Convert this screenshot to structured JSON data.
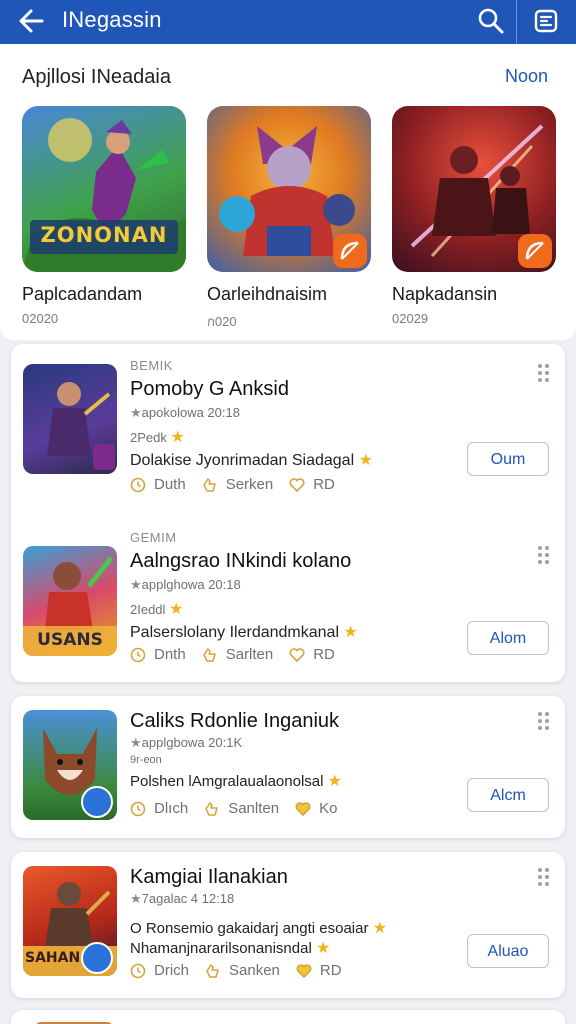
{
  "topbar": {
    "title": "INegassin",
    "icons": [
      "back-arrow-icon",
      "search-icon",
      "menu-icon"
    ],
    "color": "#1f56b8"
  },
  "featured": {
    "title": "Apjllosi INeadaia",
    "more": "Noon",
    "items": [
      {
        "name": "Paplcadandam",
        "sub": "02020",
        "thumb_text": "ZONONAN"
      },
      {
        "name": "Oarleihdnaisim",
        "sub": "ก020"
      },
      {
        "name": "Napkadansin",
        "sub": "02029"
      }
    ]
  },
  "list": [
    {
      "tag": "BEMIK",
      "name": "Pomoby G Anksid",
      "meta": "apokolowa 20:18",
      "meta2": "2Pedk",
      "desc": "Dolakise Jyonrimadan Siadagal",
      "actions": [
        "Duth",
        "Serken",
        "RD"
      ],
      "button": "Oum"
    },
    {
      "tag": "GEMIM",
      "name": "Aalngsrao INkindi kolano",
      "meta": "applghowa 20:18",
      "meta2": "2Ieddl",
      "desc": "Palserslolany Ilerdandmkanal",
      "actions": [
        "Dnth",
        "Sarlten",
        "RD"
      ],
      "button": "Alom",
      "thumb_text": "USANS"
    },
    {
      "name": "Caliks Rdonlie Inganiuk",
      "meta": "applgbowa 20:1K",
      "meta2": "9r-eon",
      "desc": "Polshen lAmgralaualaonolsal",
      "actions": [
        "Dlıch",
        "Sanlten",
        "Ko"
      ],
      "button": "Alcm"
    },
    {
      "name": "Kamgiai Ilanakian",
      "meta": "7agalac 4 12:18",
      "desc": "O Ronsemio gakaidarj angti esoaiar",
      "desc2": "Nhamanjnararilsonanisndal",
      "actions": [
        "Drich",
        "Sanken",
        "RD"
      ],
      "button": "Aluao",
      "thumb_text": "SAHAN"
    }
  ],
  "colors": {
    "accent": "#1f56b8",
    "star": "#f3b41b",
    "badge": "#f06a1e"
  }
}
